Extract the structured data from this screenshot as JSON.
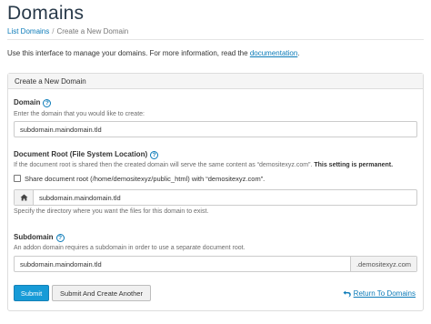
{
  "page": {
    "title": "Domains",
    "breadcrumb": [
      {
        "label": "List Domains"
      },
      {
        "label": "Create a New Domain"
      }
    ],
    "breadcrumb_separator": "/",
    "intro_text": "Use this interface to manage your domains. For more information, read the",
    "intro_link": "documentation",
    "intro_end": "."
  },
  "panel": {
    "heading": "Create a New Domain"
  },
  "domain": {
    "label": "Domain",
    "hint": "Enter the domain that you would like to create:",
    "value": "subdomain.maindomain.tld"
  },
  "docroot": {
    "label": "Document Root (File System Location)",
    "hint": "If the document root is shared then the created domain will serve the same content as “demositexyz.com”.",
    "hint_bold": "This setting is permanent",
    "hint_end": ".",
    "share_checkbox_label": "Share document root (/home/demositexyz/public_html) with “demositexyz.com”.",
    "share_checked": false,
    "value": "subdomain.maindomain.tld",
    "specify_hint": "Specify the directory where you want the files for this domain to exist."
  },
  "subdomain": {
    "label": "Subdomain",
    "hint": "An addon domain requires a subdomain in order to use a separate document root.",
    "value": "subdomain.maindomain.tld",
    "suffix": ".demositexyz.com"
  },
  "actions": {
    "submit_label": "Submit",
    "submit_another_label": "Submit And Create Another",
    "return_label": "Return To Domains"
  },
  "icons": {
    "help": "question-circle-icon",
    "home": "home-icon",
    "return": "return-arrow-icon"
  },
  "colors": {
    "accent": "#179bd7",
    "link": "#0a7ab8",
    "title": "#293a4a"
  }
}
